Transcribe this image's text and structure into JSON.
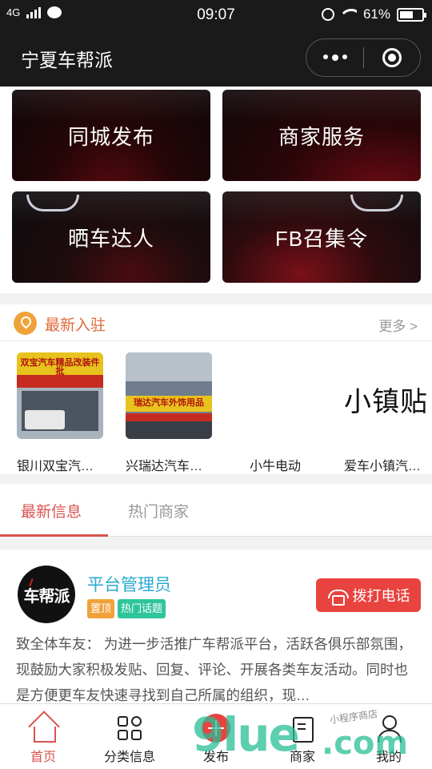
{
  "status_bar": {
    "network": "4G",
    "time": "09:07",
    "battery": "61%",
    "battery_level": 0.61
  },
  "nav": {
    "title": "宁夏车帮派"
  },
  "tiles": [
    {
      "label": "同城发布"
    },
    {
      "label": "商家服务"
    },
    {
      "label": "晒车达人"
    },
    {
      "label": "FB召集令"
    }
  ],
  "newest": {
    "title": "最新入驻",
    "more": "更多 >",
    "shops": [
      {
        "name": "银川双宝汽…",
        "sign_text": "双宝汽车精品改装件批"
      },
      {
        "name": "兴瑞达汽车…",
        "sign_text": "瑞达汽车外饰用品"
      },
      {
        "name": "小牛电动"
      },
      {
        "name": "爱车小镇汽…",
        "logo_text": "小镇贴"
      }
    ]
  },
  "tabs": [
    {
      "label": "最新信息",
      "active": true
    },
    {
      "label": "热门商家",
      "active": false
    }
  ],
  "post": {
    "avatar_text": "车帮派",
    "author": "平台管理员",
    "badges": [
      "置顶",
      "热门话题"
    ],
    "call_button": "拨打电话",
    "content": "致全体车友： 为进一步活推广车帮派平台，活跃各俱乐部氛围，现鼓励大家积极发贴、回复、评论、开展各类车友活动。同时也是方便更车友快速寻找到自己所属的组织，现…"
  },
  "tabbar": [
    {
      "label": "首页",
      "icon": "home-icon",
      "active": true
    },
    {
      "label": "分类信息",
      "icon": "category-icon",
      "active": false
    },
    {
      "label": "发布",
      "icon": "publish-icon",
      "active": false
    },
    {
      "label": "商家",
      "icon": "shop-icon",
      "active": false
    },
    {
      "label": "我的",
      "icon": "user-icon",
      "active": false
    }
  ],
  "watermark": {
    "big": "9lue",
    "com": ".com",
    "small": "小程序商店"
  },
  "colors": {
    "accent_red": "#d9534f",
    "author_blue": "#2aa9cf",
    "badge_orange": "#f0a23a",
    "badge_green": "#2fc59a",
    "title_orange": "#e06a3a"
  }
}
